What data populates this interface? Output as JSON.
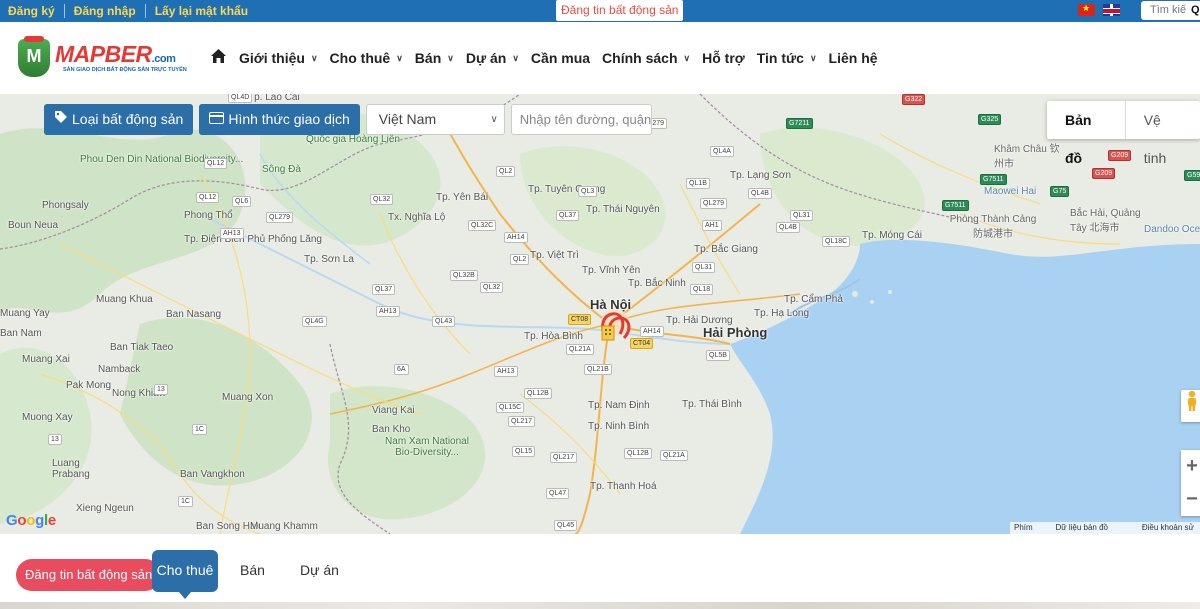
{
  "topbar": {
    "register": "Đăng ký",
    "login": "Đăng nhập",
    "forgot": "Lấy lại mật khẩu",
    "post_listing": "Đăng tin bất động sản",
    "search_placeholder": "Tìm kiế",
    "flags": [
      "vietnam-flag-icon",
      "uk-flag-icon"
    ]
  },
  "logo": {
    "mark": "M",
    "name": "MAPBER",
    "tld": ".com",
    "slogan": "SÀN GIAO DỊCH BẤT ĐỘNG SẢN TRỰC TUYẾN"
  },
  "nav": {
    "items": [
      {
        "label": "Giới thiệu",
        "dropdown": true
      },
      {
        "label": "Cho thuê",
        "dropdown": true
      },
      {
        "label": "Bán",
        "dropdown": true
      },
      {
        "label": "Dự án",
        "dropdown": true
      },
      {
        "label": "Cần mua",
        "dropdown": false
      },
      {
        "label": "Chính sách",
        "dropdown": true
      },
      {
        "label": "Hỗ trợ",
        "dropdown": false
      },
      {
        "label": "Tin tức",
        "dropdown": true
      },
      {
        "label": "Liên hệ",
        "dropdown": false
      }
    ]
  },
  "filters": {
    "property_type": "Loại bất động sản",
    "transaction_type": "Hình thức giao dịch",
    "country": "Việt Nam",
    "address_placeholder": "Nhập tên đường, quận h"
  },
  "map": {
    "type_map": "Bản đồ",
    "type_satellite": "Vệ tinh",
    "zoom_in": "+",
    "zoom_out": "−",
    "google": "Google",
    "attribution": [
      "Phím tắt",
      "Dữ liệu bản đồ ©2021",
      "Điều khoản sử d"
    ],
    "labels": [
      "Phou Den Din National Biodiversity...",
      "Quốc gia Hoàng Liên",
      "Tp. Lào Cai",
      "Sông Đà",
      "Tp. Yên Bái",
      "Tp. Tuyên Quang",
      "Tx. Nghĩa Lộ",
      "Tp. Thái Nguyên",
      "Tp. Lạng Sơn",
      "Tp. Điện Biên Phủ",
      "Phong Thổ",
      "Phongsaly",
      "Boun Neua",
      "Phống Lăng",
      "Tp. Sơn La",
      "Tp. Việt Trì",
      "Tp. Vĩnh Yên",
      "Tp. Bắc Ninh",
      "Tp. Bắc Giang",
      "Hà Nội",
      "Tp. Hải Dương",
      "Hải Phòng",
      "Tp. Hòa Bình",
      "Tp. Hạ Long",
      "Tp. Cẩm Phả",
      "Tp. Móng Cái",
      "Muang Khua",
      "Ban Nasang",
      "Muang Xai",
      "Ban Tiak Taeo",
      "Namback",
      "Pak Mong",
      "Nong Khiaw",
      "Muang Xon",
      "Viang Kai",
      "Ban Kho",
      "Nam Xam National Bio-Diversity...",
      "Tp. Nam Định",
      "Tp. Thái Bình",
      "Tp. Ninh Bình",
      "Tp. Thanh Hoá",
      "Luang Prabang",
      "Ban Vangkhon",
      "Xieng Ngeun",
      "Ban Song Hak",
      "Muang Khamm",
      "Khâm Châu 钦州市",
      "Phòng Thành Cảng 防城港市",
      "Bắc Hải, Quảng Tây 北海市",
      "Maowei Hai",
      "Dandoo Ocean",
      "Muang Yay",
      "Ban Nam",
      "Muong Xay"
    ]
  },
  "tabs": {
    "post_listing": "Đăng tin bất động sản",
    "rent": "Cho thuê",
    "sell": "Bán",
    "project": "Dự án"
  }
}
